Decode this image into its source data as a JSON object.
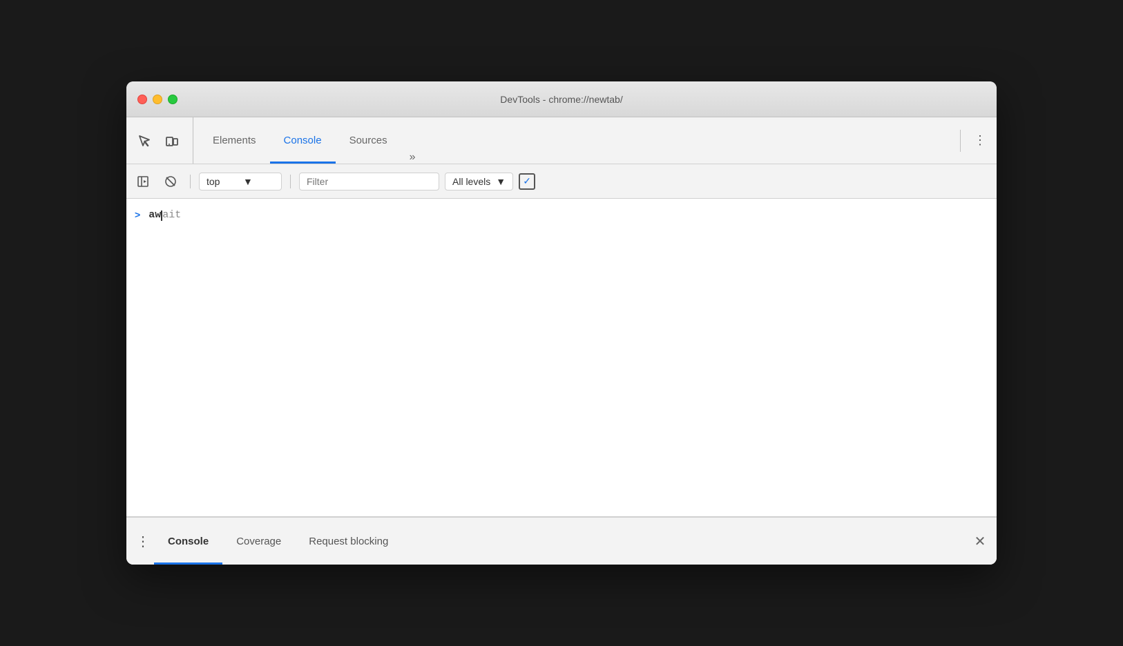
{
  "window": {
    "title": "DevTools - chrome://newtab/"
  },
  "titlebar": {
    "close": "close",
    "minimize": "minimize",
    "maximize": "maximize"
  },
  "main_toolbar": {
    "tabs": [
      {
        "id": "elements",
        "label": "Elements",
        "active": false
      },
      {
        "id": "console",
        "label": "Console",
        "active": true
      },
      {
        "id": "sources",
        "label": "Sources",
        "active": false
      }
    ],
    "more_label": "»",
    "kebab_label": "⋮"
  },
  "console_toolbar": {
    "context_value": "top",
    "filter_placeholder": "Filter",
    "levels_label": "All levels",
    "levels_arrow": "▼"
  },
  "console": {
    "arrow": ">",
    "typed_text": "aw",
    "autocomplete_text": "ait"
  },
  "bottom_panel": {
    "tabs": [
      {
        "id": "console",
        "label": "Console",
        "active": true
      },
      {
        "id": "coverage",
        "label": "Coverage",
        "active": false
      },
      {
        "id": "request-blocking",
        "label": "Request blocking",
        "active": false
      }
    ],
    "close_label": "✕",
    "kebab_label": "⋮"
  }
}
